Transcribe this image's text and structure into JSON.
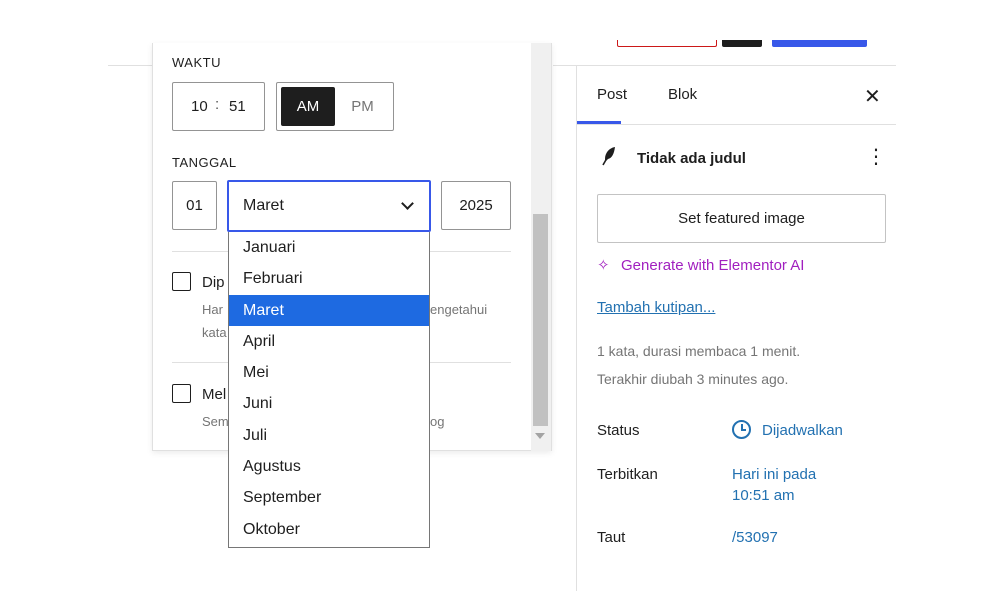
{
  "time": {
    "label": "WAKTU",
    "hour": "10",
    "separator": ":",
    "minute": "51",
    "am": "AM",
    "pm": "PM"
  },
  "date": {
    "label": "TANGGAL",
    "day": "01",
    "month_selected": "Maret",
    "year": "2025"
  },
  "months": [
    "Januari",
    "Februari",
    "Maret",
    "April",
    "Mei",
    "Juni",
    "Juli",
    "Agustus",
    "September",
    "Oktober"
  ],
  "options": {
    "pinned_label": "Dip",
    "pinned_help_1": "Har",
    "pinned_help_1_end": "engetahui",
    "pinned_help_2": "kata",
    "pending_label": "Mel",
    "pending_help": "Sem",
    "pending_help_end": "og"
  },
  "sidebar": {
    "tab_post": "Post",
    "tab_block": "Blok",
    "post_title": "Tidak ada judul",
    "featured_image_button": "Set featured image",
    "elementor_ai": "Generate with Elementor AI",
    "add_excerpt": "Tambah kutipan...",
    "word_count": "1 kata, durasi membaca 1 menit.",
    "last_modified": "Terakhir diubah 3 minutes ago.",
    "status_label": "Status",
    "status_value": "Dijadwalkan",
    "publish_label": "Terbitkan",
    "publish_value_1": "Hari ini pada",
    "publish_value_2": "10:51 am",
    "link_label": "Taut",
    "link_value": "/53097"
  },
  "colors": {
    "accent": "#3858e9",
    "selected_option": "#1e6ae1",
    "link": "#2271b1",
    "elementor": "#a11fbf"
  },
  "icons": [
    "close-icon",
    "feather-icon",
    "kebab-menu-icon",
    "sparkle-icon",
    "clock-icon",
    "chevron-down-icon"
  ]
}
